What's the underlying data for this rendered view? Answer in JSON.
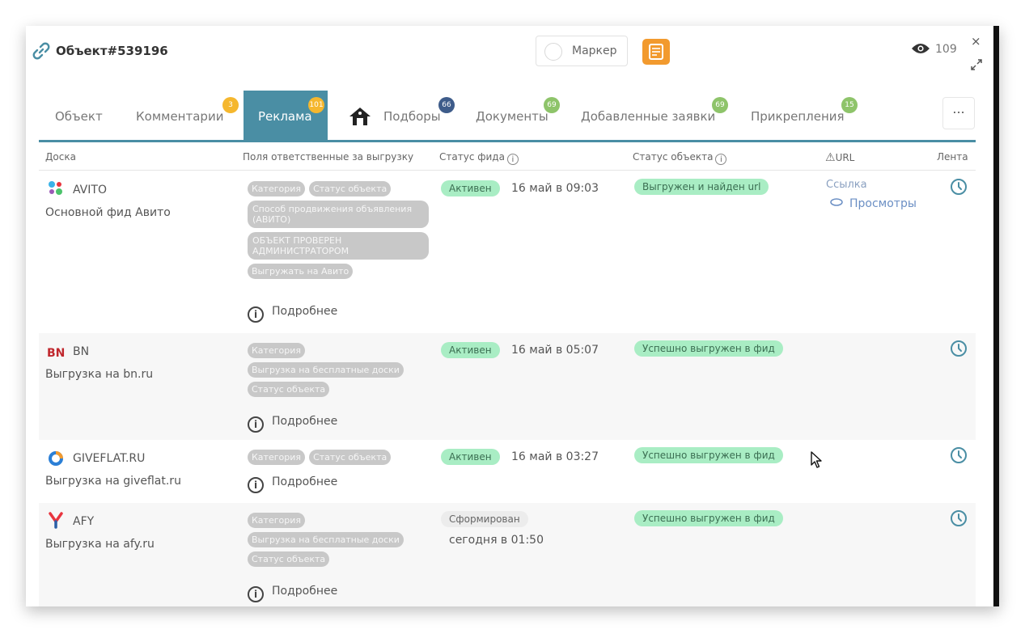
{
  "header": {
    "title": "Объект#539196",
    "marker_label": "Маркер",
    "views_count": "109",
    "close_symbol": "×"
  },
  "tabs": [
    {
      "label": "Объект"
    },
    {
      "label": "Комментарии",
      "badge": "3",
      "badge_color": "#f5b72e"
    },
    {
      "label": "Реклама",
      "badge": "101",
      "badge_color": "#f5b72e",
      "active": true
    },
    {
      "label": "Подборы",
      "badge": "66",
      "badge_color": "#3e5c8a"
    },
    {
      "label": "Документы",
      "badge": "69",
      "badge_color": "#8ec46a"
    },
    {
      "label": "Добавленные заявки",
      "badge": "69",
      "badge_color": "#8ec46a"
    },
    {
      "label": "Прикрепления",
      "badge": "15",
      "badge_color": "#8ec46a"
    }
  ],
  "more_label": "...",
  "columns": {
    "board": "Доска",
    "fields": "Поля ответственные за выгрузку",
    "feed_status": "Статус фида",
    "object_status": "Статус объекта",
    "url": "URL",
    "feed": "Лента"
  },
  "info_symbol": "i",
  "warning_symbol": "⚠",
  "rows": [
    {
      "name": "AVITO",
      "desc": "Основной фид Авито",
      "chips": [
        "Категория",
        "Статус объекта",
        "Способ продвижения объявления (АВИТО)",
        "ОБЪЕКТ ПРОВЕРЕН АДМИНИСТРАТОРОМ",
        "Выгружать на Авито"
      ],
      "more": "Подробнее",
      "feed_status": "Активен",
      "date": "16 май в 09:03",
      "object_status": "Выгружен и найден url",
      "url": "Ссылка",
      "views": "Просмотры"
    },
    {
      "name": "BN",
      "desc": "Выгрузка на bn.ru",
      "chips": [
        "Категория",
        "Выгрузка на бесплатные доски",
        "Статус объекта"
      ],
      "more": "Подробнее",
      "feed_status": "Активен",
      "date": "16 май в 05:07",
      "object_status": "Успешно выгружен в фид"
    },
    {
      "name": "GIVEFLAT.RU",
      "desc": "Выгрузка на giveflat.ru",
      "chips": [
        "Категория",
        "Статус объекта"
      ],
      "more": "Подробнее",
      "feed_status": "Активен",
      "date": "16 май в 03:27",
      "object_status": "Успешно выгружен в фид"
    },
    {
      "name": "AFY",
      "desc": "Выгрузка на afy.ru",
      "chips": [
        "Категория",
        "Выгрузка на бесплатные доски",
        "Статус объекта"
      ],
      "more": "Подробнее",
      "feed_status": "Сформирован",
      "date": "сегодня в 01:50",
      "object_status": "Успешно выгружен в фид"
    }
  ],
  "colors": {
    "accent": "#4a8ea4",
    "status_green": "#a9edc4",
    "chip_grey": "#c8c8c8",
    "orange": "#f29a2e"
  },
  "icons": [
    "link-icon",
    "eye-icon",
    "close-icon",
    "expand-icon",
    "info-icon",
    "warning-icon",
    "clock-icon",
    "views-icon",
    "podbory-icon",
    "cursor-icon"
  ]
}
